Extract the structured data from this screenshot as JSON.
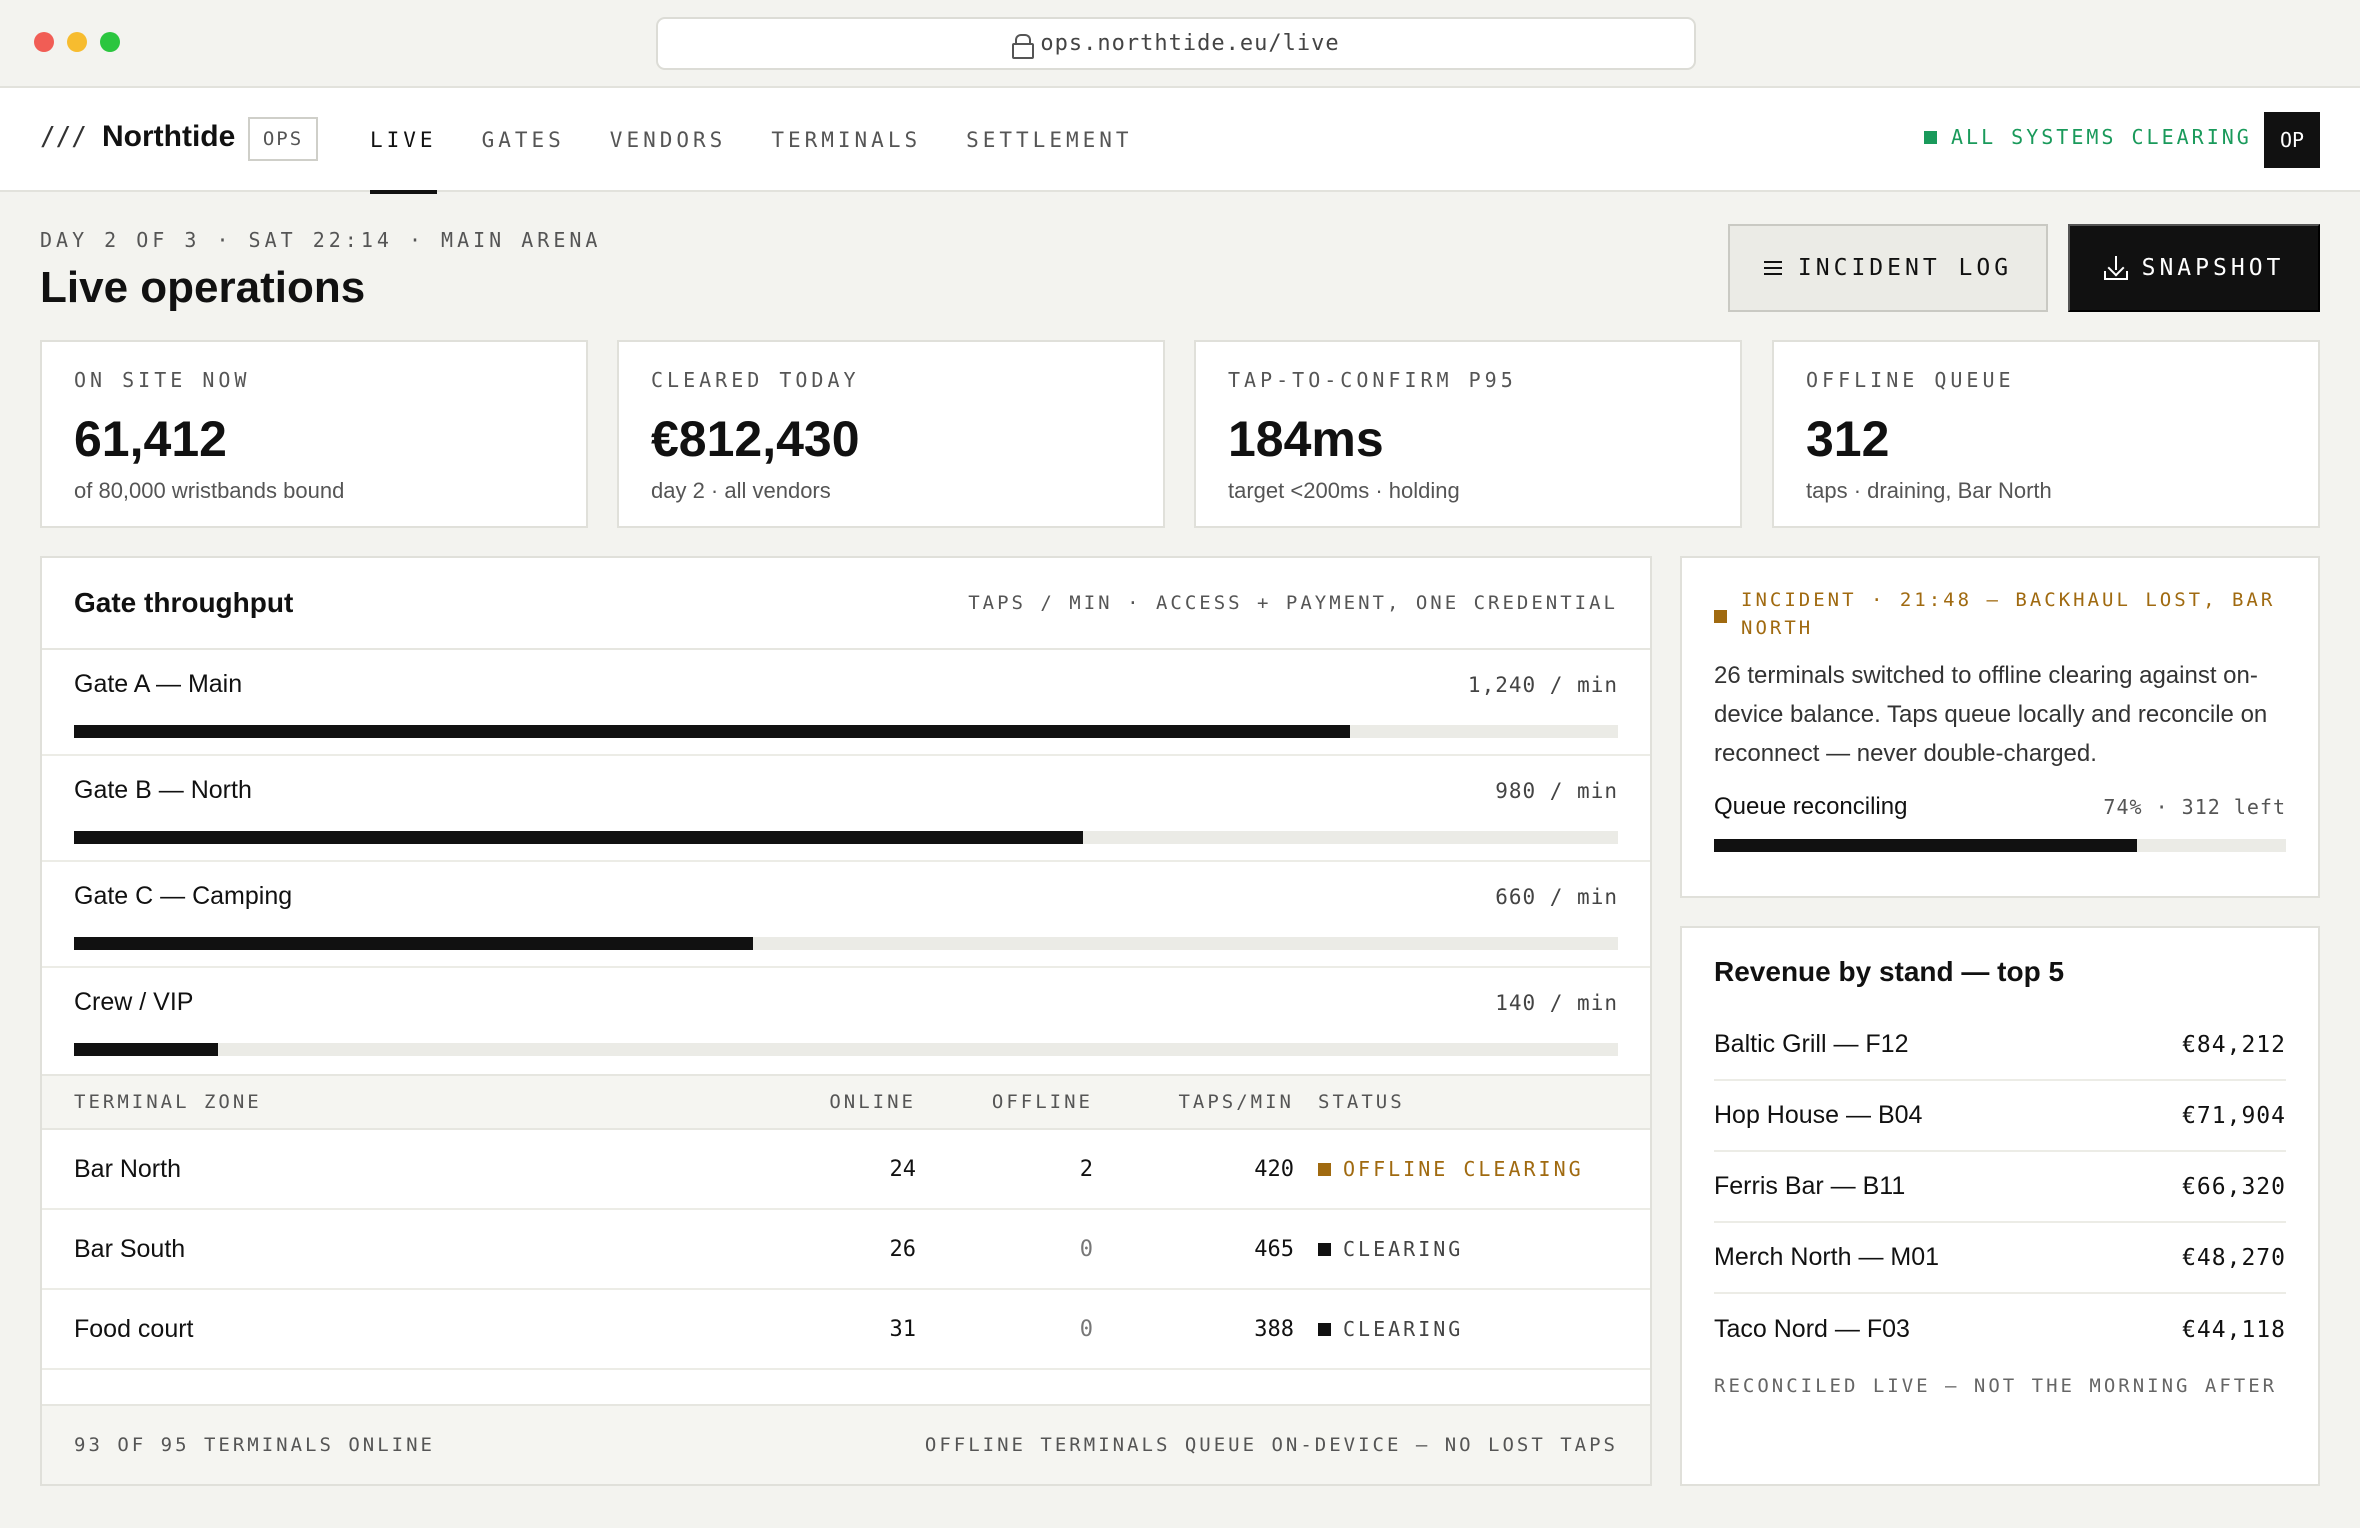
{
  "browser": {
    "url": "ops.northtide.eu/live"
  },
  "header": {
    "brand_mark": "///",
    "brand": "Northtide",
    "badge": "OPS",
    "nav": [
      "LIVE",
      "GATES",
      "VENDORS",
      "TERMINALS",
      "SETTLEMENT"
    ],
    "active_nav": "LIVE",
    "system_status": "ALL SYSTEMS CLEARING",
    "system_status_color": "#1a9a5b",
    "avatar": "OP"
  },
  "page": {
    "eyebrow": "DAY 2 OF 3 · SAT 22:14 · MAIN ARENA",
    "title": "Live operations",
    "incident_log_label": "INCIDENT LOG",
    "snapshot_label": "SNAPSHOT"
  },
  "kpis": [
    {
      "label": "ON SITE NOW",
      "value": "61,412",
      "sub": "of 80,000 wristbands bound"
    },
    {
      "label": "CLEARED TODAY",
      "value": "€812,430",
      "sub": "day 2 · all vendors"
    },
    {
      "label": "TAP-TO-CONFIRM P95",
      "value": "184ms",
      "sub": "target <200ms · holding"
    },
    {
      "label": "OFFLINE QUEUE",
      "value": "312",
      "sub": "taps · draining, Bar North"
    }
  ],
  "gates": {
    "title": "Gate throughput",
    "meta": "TAPS / MIN · ACCESS + PAYMENT, ONE CREDENTIAL",
    "scale_max": 1500,
    "rows": [
      {
        "name": "Gate A — Main",
        "rate": "1,240 / min",
        "value": 1240
      },
      {
        "name": "Gate B — North",
        "rate": "980 / min",
        "value": 980
      },
      {
        "name": "Gate C — Camping",
        "rate": "660 / min",
        "value": 660
      },
      {
        "name": "Crew / VIP",
        "rate": "140 / min",
        "value": 140
      }
    ]
  },
  "terminals": {
    "columns": {
      "zone": "TERMINAL ZONE",
      "online": "ONLINE",
      "offline": "OFFLINE",
      "taps": "TAPS/MIN",
      "status": "STATUS"
    },
    "rows": [
      {
        "zone": "Bar North",
        "online": "24",
        "offline": "2",
        "taps": "420",
        "status": "OFFLINE CLEARING"
      },
      {
        "zone": "Bar South",
        "online": "26",
        "offline": "0",
        "taps": "465",
        "status": "CLEARING"
      },
      {
        "zone": "Food court",
        "online": "31",
        "offline": "0",
        "taps": "388",
        "status": "CLEARING"
      }
    ],
    "footer_left": "93 OF 95 TERMINALS ONLINE",
    "footer_right": "OFFLINE TERMINALS QUEUE ON-DEVICE — NO LOST TAPS",
    "warn_color": "#a06a10"
  },
  "incident": {
    "label": "INCIDENT",
    "time": "21:48",
    "headline": "BACKHAUL LOST, BAR NORTH",
    "body": "26 terminals switched to offline clearing against on-device balance. Taps queue locally and reconcile on reconnect — never double-charged.",
    "progress_label": "Queue reconciling",
    "progress_percent": "74%",
    "progress_left": "312 left",
    "progress_value": 0.74
  },
  "revenue": {
    "title": "Revenue by stand — top 5",
    "rows": [
      {
        "name": "Baltic Grill — F12",
        "value": "€84,212"
      },
      {
        "name": "Hop House — B04",
        "value": "€71,904"
      },
      {
        "name": "Ferris Bar — B11",
        "value": "€66,320"
      },
      {
        "name": "Merch North — M01",
        "value": "€48,270"
      },
      {
        "name": "Taco Nord — F03",
        "value": "€44,118"
      }
    ],
    "note": "RECONCILED LIVE — NOT THE MORNING AFTER"
  }
}
